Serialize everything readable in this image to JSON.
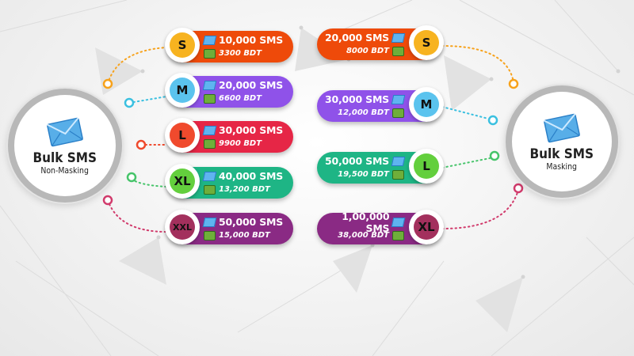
{
  "colors": {
    "S": "#ee4a0a",
    "M": "#8f52e9",
    "L": "#e62646",
    "XL": "#1eb585",
    "XXL": "#8a2a84",
    "badge_S": "#f7b320",
    "badge_M": "#5bc3ee",
    "badge_L": "#f04a2d",
    "badge_XL": "#63cf3d",
    "badge_XXL": "#a3305d"
  },
  "non_masking": {
    "title": "Bulk SMS",
    "subtitle": "Non-Masking",
    "icon": "envelope-icon",
    "packages": [
      {
        "size": "S",
        "sms": "10,000 SMS",
        "price": "3300 BDT"
      },
      {
        "size": "M",
        "sms": "20,000 SMS",
        "price": "6600 BDT"
      },
      {
        "size": "L",
        "sms": "30,000 SMS",
        "price": "9900 BDT"
      },
      {
        "size": "XL",
        "sms": "40,000 SMS",
        "price": "13,200 BDT"
      },
      {
        "size": "XXL",
        "sms": "50,000 SMS",
        "price": "15,000 BDT"
      }
    ]
  },
  "masking": {
    "title": "Bulk SMS",
    "subtitle": "Masking",
    "icon": "envelope-icon",
    "packages": [
      {
        "size": "S",
        "sms": "20,000 SMS",
        "price": "8000 BDT"
      },
      {
        "size": "M",
        "sms": "30,000 SMS",
        "price": "12,000 BDT"
      },
      {
        "size": "L",
        "sms": "50,000 SMS",
        "price": "19,500 BDT"
      },
      {
        "size": "XL",
        "sms": "1,00,000 SMS",
        "price": "38,000 BDT"
      }
    ]
  }
}
